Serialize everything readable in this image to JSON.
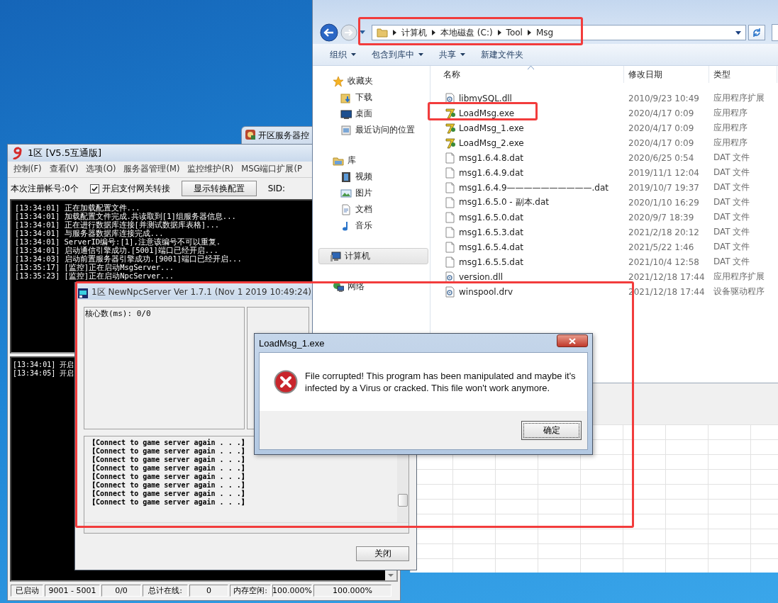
{
  "background_window": {
    "title": "开区服务器控"
  },
  "server_window": {
    "title": "1区 [V5.5互通版]",
    "menu": [
      "控制(F)",
      "查看(V)",
      "选项(O)",
      "服务器管理(M)",
      "监控维护(R)",
      "MSG端口扩展(P"
    ],
    "toolbar": {
      "registered": "本次注册帐号:0个",
      "gateway_checkbox": {
        "label": "开启支付网关转接",
        "checked": true
      },
      "config_button": "显示转换配置",
      "sid_label": "SID:"
    },
    "log": [
      "[13:34:01] 正在加载配置文件...",
      "[13:34:01] 加载配置文件完成.共读取到[1]组服务器信息...",
      "[13:34:01] 正在进行数据库连接[并测试数据库表格]...",
      "[13:34:01] 与服务器数据库连接完成...",
      "[13:34:01] ServerID编号:[1],注意该编号不可以重复.",
      "[13:34:01] 启动通信引擎成功.[5001]端口已经开启...",
      "[13:34:03] 启动前置服务器引擎成功.[9001]端口已经开启...",
      "[13:35:17] [监控]正在启动MsgServer...",
      "[13:35:23] [监控]正在启动NpcServer..."
    ],
    "log_2": [
      "[13:34:01] 开启",
      "[13:34:05] 开启"
    ],
    "status_bar": [
      "已启动",
      "9001 - 5001",
      "0/0",
      "总计在线:",
      "0",
      "内存空闲:",
      "100.000%",
      "100.000%"
    ]
  },
  "explorer": {
    "address": [
      "计算机",
      "本地磁盘 (C:)",
      "Tool",
      "Msg"
    ],
    "toolbar": [
      {
        "label": "组织",
        "dropdown": true
      },
      {
        "label": "包含到库中",
        "dropdown": true
      },
      {
        "label": "共享",
        "dropdown": true
      },
      {
        "label": "新建文件夹",
        "dropdown": false
      }
    ],
    "nav": [
      {
        "label": "收藏夹",
        "kind": "star",
        "selected": false,
        "children": [
          {
            "label": "下载",
            "kind": "download",
            "selected": false
          },
          {
            "label": "桌面",
            "kind": "desktop",
            "selected": false
          },
          {
            "label": "最近访问的位置",
            "kind": "recent",
            "selected": false
          }
        ]
      },
      {
        "label": "库",
        "kind": "library",
        "selected": false,
        "children": [
          {
            "label": "视频",
            "kind": "video",
            "selected": false
          },
          {
            "label": "图片",
            "kind": "picture",
            "selected": false
          },
          {
            "label": "文档",
            "kind": "document",
            "selected": false
          },
          {
            "label": "音乐",
            "kind": "music",
            "selected": false
          }
        ]
      },
      {
        "label": "计算机",
        "kind": "computer",
        "selected": true
      },
      {
        "label": "网络",
        "kind": "network",
        "selected": false
      }
    ],
    "columns": [
      "名称",
      "修改日期",
      "类型"
    ],
    "files": [
      {
        "name": "libmySQL.dll",
        "modified": "2010/9/23 10:49",
        "type": "应用程序扩展",
        "kind": "dll"
      },
      {
        "name": "LoadMsg.exe",
        "modified": "2020/4/17 0:09",
        "type": "应用程序",
        "kind": "exe"
      },
      {
        "name": "LoadMsg_1.exe",
        "modified": "2020/4/17 0:09",
        "type": "应用程序",
        "kind": "exe"
      },
      {
        "name": "LoadMsg_2.exe",
        "modified": "2020/4/17 0:09",
        "type": "应用程序",
        "kind": "exe"
      },
      {
        "name": "msg1.6.4.8.dat",
        "modified": "2020/6/25 0:54",
        "type": "DAT 文件",
        "kind": "dat"
      },
      {
        "name": "msg1.6.4.9.dat",
        "modified": "2019/11/1 12:04",
        "type": "DAT 文件",
        "kind": "dat"
      },
      {
        "name": "msg1.6.4.9——————————.dat",
        "modified": "2019/10/7 19:37",
        "type": "DAT 文件",
        "kind": "dat"
      },
      {
        "name": "msg1.6.5.0 - 副本.dat",
        "modified": "2020/1/10 16:29",
        "type": "DAT 文件",
        "kind": "dat"
      },
      {
        "name": "msg1.6.5.0.dat",
        "modified": "2020/9/7 18:39",
        "type": "DAT 文件",
        "kind": "dat"
      },
      {
        "name": "msg1.6.5.3.dat",
        "modified": "2021/2/18 20:12",
        "type": "DAT 文件",
        "kind": "dat"
      },
      {
        "name": "msg1.6.5.4.dat",
        "modified": "2021/5/22 1:46",
        "type": "DAT 文件",
        "kind": "dat"
      },
      {
        "name": "msg1.6.5.5.dat",
        "modified": "2021/10/4 12:58",
        "type": "DAT 文件",
        "kind": "dat"
      },
      {
        "name": "version.dll",
        "modified": "2021/12/18 17:44",
        "type": "应用程序扩展",
        "kind": "dll"
      },
      {
        "name": "winspool.drv",
        "modified": "2021/12/18 17:44",
        "type": "设备驱动程序",
        "kind": "dll"
      }
    ]
  },
  "npc_window": {
    "title": "1区 NewNpcServer Ver 1.7.1 (Nov  1 2019 10:49:24)",
    "core_label": "核心数(ms): 0/0",
    "log": [
      "【Connect to game server again . . .】",
      "【Connect to game server again . . .】",
      "【Connect to game server again . . .】",
      "【Connect to game server again . . .】",
      "【Connect to game server again . . .】",
      "【Connect to game server again . . .】",
      "【Connect to game server again . . .】",
      "【Connect to game server again . . .】"
    ],
    "close_button": "关闭"
  },
  "dialog": {
    "title": "LoadMsg_1.exe",
    "message": "File corrupted! This program has been manipulated and maybe it's infected by a Virus or cracked. This file won't work anymore.",
    "ok_button": "确定"
  }
}
